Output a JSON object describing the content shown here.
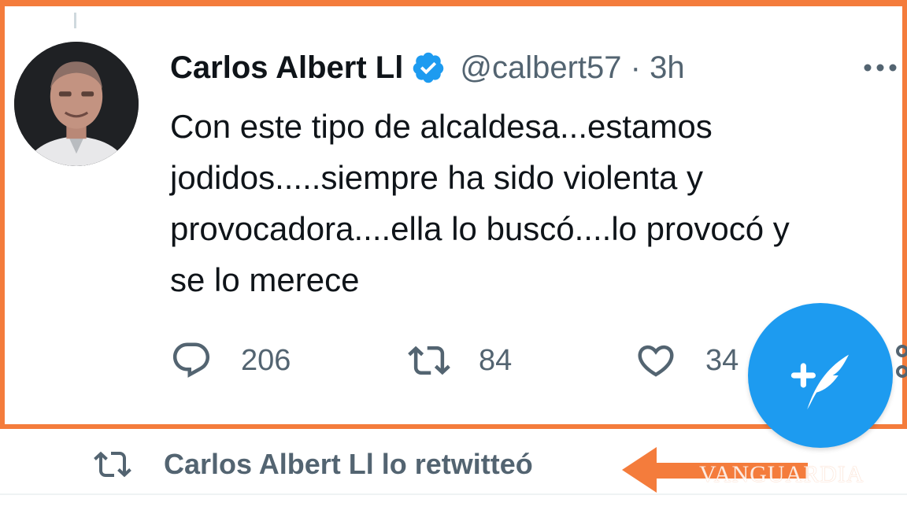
{
  "tweet": {
    "author": {
      "display_name": "Carlos Albert Ll",
      "handle": "@calbert57",
      "time": "3h",
      "verified": true
    },
    "text": "Con este tipo de alcaldesa...estamos\njodidos.....siempre ha sido violenta y\nprovocadora....ella lo buscó....lo provocó   y\nse lo merece",
    "stats": {
      "replies": "206",
      "retweets": "84",
      "likes": "34"
    }
  },
  "retweet_context": {
    "label": "Carlos Albert Ll lo retwitteó"
  },
  "watermark": "VANGUARDIA",
  "colors": {
    "accent_blue": "#1d9bf0",
    "highlight_orange": "#f47c3c",
    "text_primary": "#0f1419",
    "text_secondary": "#536471"
  },
  "icons": {
    "verified": "verified-badge-icon",
    "more": "more-dots-icon",
    "reply": "reply-icon",
    "retweet": "retweet-icon",
    "like": "heart-icon",
    "share": "share-icon",
    "compose": "compose-tweet-icon",
    "arrow": "arrow-left-icon"
  }
}
